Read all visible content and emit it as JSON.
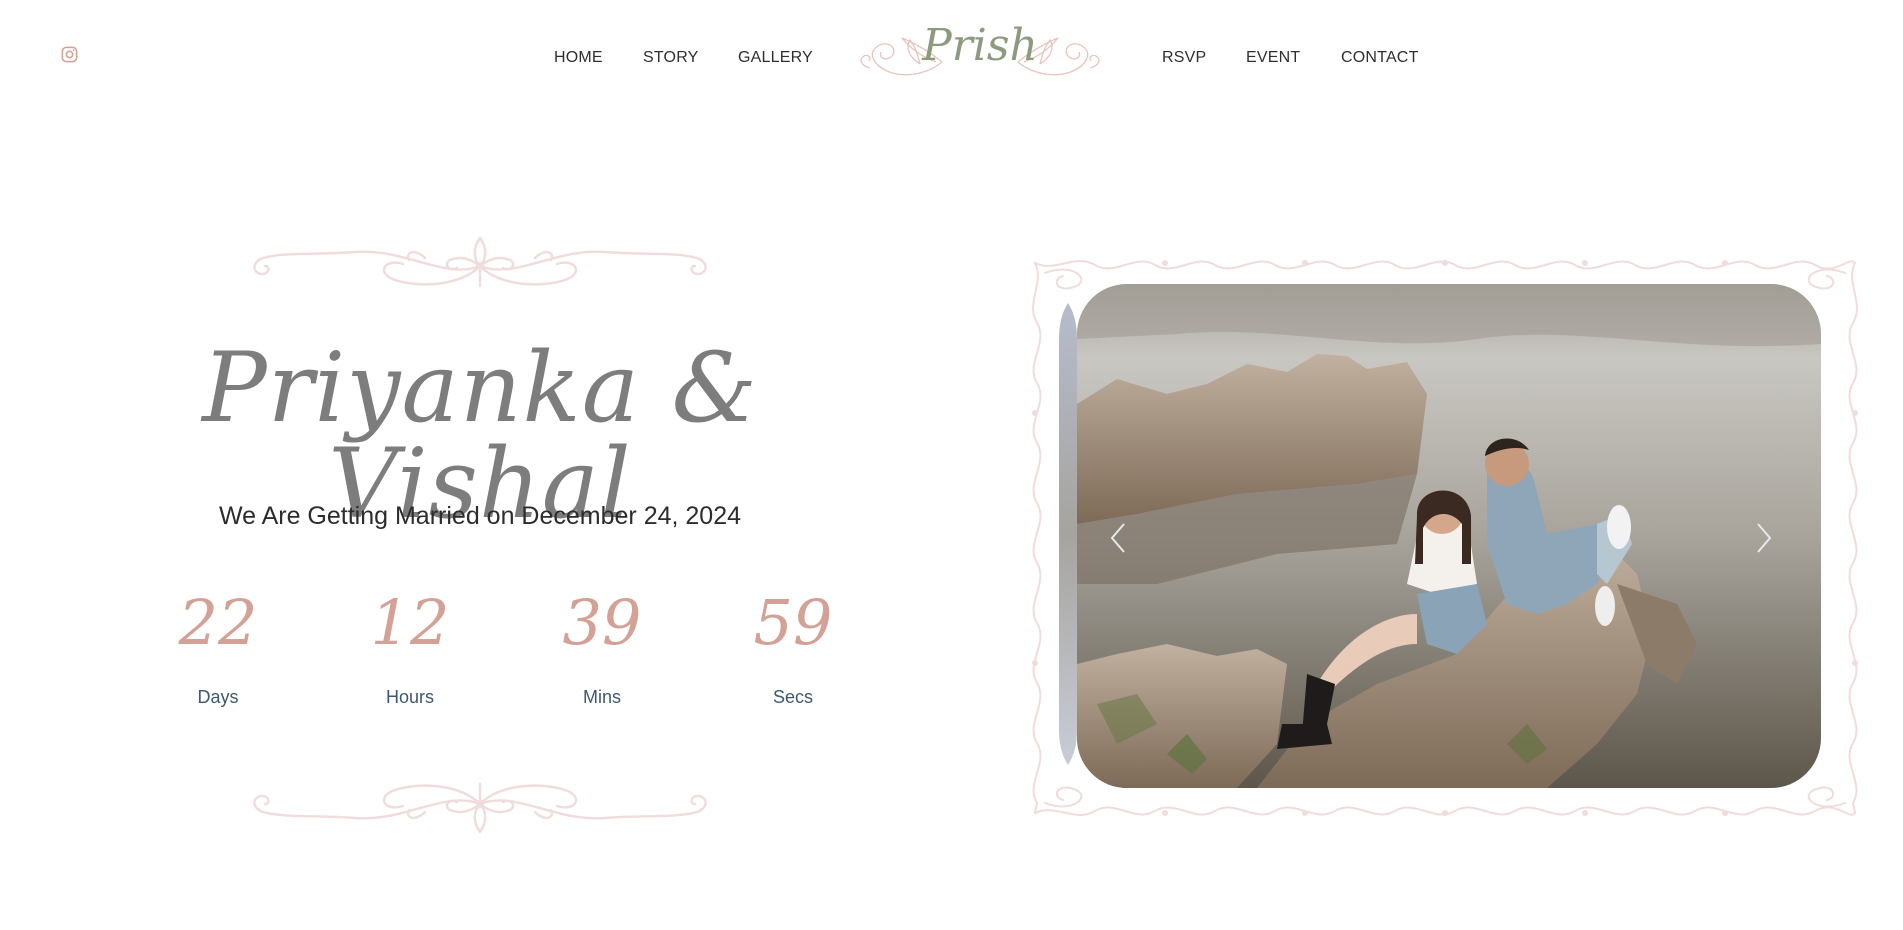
{
  "header": {
    "instagram_icon": "instagram-icon",
    "nav_left": [
      "HOME",
      "STORY",
      "GALLERY"
    ],
    "nav_right": [
      "RSVP",
      "EVENT",
      "CONTACT"
    ],
    "logo_text": "Prish"
  },
  "hero": {
    "names": "Priyanka & Vishal",
    "subtitle": "We Are Getting Married on December 24, 2024",
    "countdown": [
      {
        "value": "22",
        "label": "Days"
      },
      {
        "value": "12",
        "label": "Hours"
      },
      {
        "value": "39",
        "label": "Mins"
      },
      {
        "value": "59",
        "label": "Secs"
      }
    ]
  },
  "carousel": {
    "prev_icon": "chevron-left-icon",
    "next_icon": "chevron-right-icon"
  },
  "colors": {
    "accent": "#d3a196",
    "ornament": "#f0dcda",
    "logo_green": "#8c9b7e",
    "label_blue": "#3e5872",
    "title_gray": "#7d7d7d"
  }
}
